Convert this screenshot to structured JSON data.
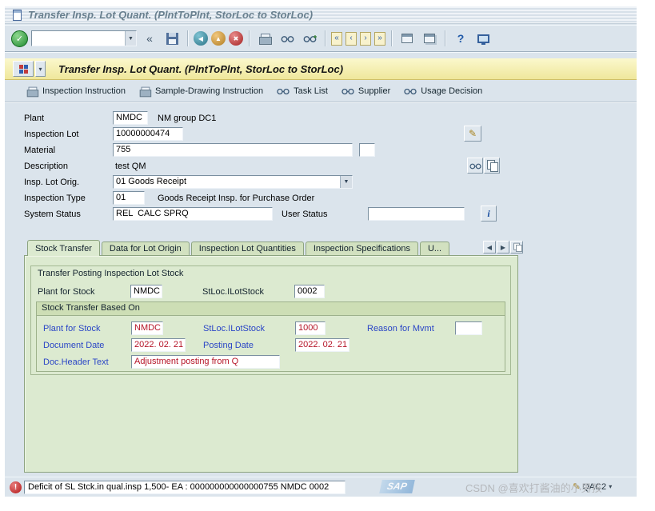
{
  "window": {
    "title": "Transfer Insp. Lot Quant. (PlntToPlnt, StorLoc to StorLoc)"
  },
  "toolbar": {
    "command_value": ""
  },
  "header": {
    "title": "Transfer Insp. Lot Quant. (PlntToPlnt, StorLoc to StorLoc)"
  },
  "app_toolbar": {
    "buttons": [
      {
        "label": "Inspection Instruction",
        "icon": "printer-icon"
      },
      {
        "label": "Sample-Drawing Instruction",
        "icon": "printer-icon"
      },
      {
        "label": "Task List",
        "icon": "glasses-icon"
      },
      {
        "label": "Supplier",
        "icon": "glasses-icon"
      },
      {
        "label": "Usage Decision",
        "icon": "glasses-icon"
      }
    ]
  },
  "form": {
    "plant_label": "Plant",
    "plant_value": "NMDC",
    "plant_desc": "NM group DC1",
    "inspection_lot_label": "Inspection Lot",
    "inspection_lot_value": "10000000474",
    "material_label": "Material",
    "material_value": "755",
    "description_label": "Description",
    "description_value": "test QM",
    "insp_lot_orig_label": "Insp. Lot Orig.",
    "insp_lot_orig_value": "01 Goods Receipt",
    "inspection_type_label": "Inspection Type",
    "inspection_type_value": "01",
    "inspection_type_desc": "Goods Receipt Insp. for Purchase Order",
    "system_status_label": "System Status",
    "system_status_value": "REL  CALC SPRQ",
    "user_status_label": "User Status",
    "user_status_value": ""
  },
  "tabs": {
    "items": [
      {
        "label": "Stock Transfer",
        "active": true
      },
      {
        "label": "Data for Lot Origin",
        "active": false
      },
      {
        "label": "Inspection Lot Quantities",
        "active": false
      },
      {
        "label": "Inspection Specifications",
        "active": false
      },
      {
        "label": "U...",
        "active": false
      }
    ]
  },
  "panel": {
    "group_title": "Transfer Posting Inspection Lot Stock",
    "pfs_label": "Plant for Stock",
    "pfs_value": "NMDC",
    "stloc_label": "StLoc.ILotStock",
    "stloc_value": "0002",
    "based_on_title": "Stock Transfer Based On",
    "bo_plant_label": "Plant for Stock",
    "bo_plant_value": "NMDC",
    "bo_stloc_label": "StLoc.ILotStock",
    "bo_stloc_value": "1000",
    "bo_reason_label": "Reason for Mvmt",
    "bo_reason_value": "",
    "bo_doc_date_label": "Document Date",
    "bo_doc_date_value": "2022. 02. 21",
    "bo_post_date_label": "Posting Date",
    "bo_post_date_value": "2022. 02. 21",
    "bo_text_label": "Doc.Header Text",
    "bo_text_value": "Adjustment posting from Q"
  },
  "status_bar": {
    "message": "Deficit of SL Stck.in qual.insp 1,500- EA : 000000000000000755 NMDC 0002",
    "system": "QAC2",
    "logo": "SAP"
  },
  "watermark": "CSDN @喜欢打酱油的小男孩",
  "icons": {
    "check": "✓",
    "dropdown": "▼",
    "collapse": "«",
    "back": "◀",
    "up": "▲",
    "cancel": "✖",
    "page_first": "«",
    "page_prev": "‹",
    "page_next": "›",
    "page_last": "»",
    "help": "?",
    "info": "i",
    "pencil": "✎",
    "error": "!",
    "tab_left": "◀",
    "tab_right": "▶",
    "status_arrow": "▾"
  }
}
